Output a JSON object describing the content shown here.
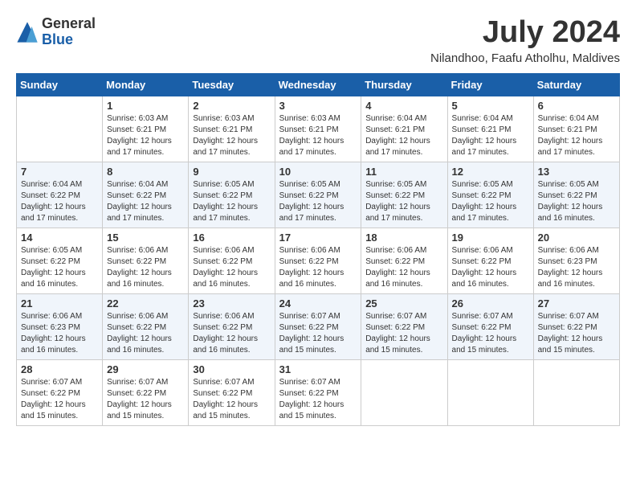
{
  "header": {
    "logo": {
      "general": "General",
      "blue": "Blue"
    },
    "title": "July 2024",
    "location": "Nilandhoo, Faafu Atholhu, Maldives"
  },
  "calendar": {
    "days_of_week": [
      "Sunday",
      "Monday",
      "Tuesday",
      "Wednesday",
      "Thursday",
      "Friday",
      "Saturday"
    ],
    "weeks": [
      [
        {
          "day": "",
          "sunrise": "",
          "sunset": "",
          "daylight": ""
        },
        {
          "day": "1",
          "sunrise": "Sunrise: 6:03 AM",
          "sunset": "Sunset: 6:21 PM",
          "daylight": "Daylight: 12 hours and 17 minutes."
        },
        {
          "day": "2",
          "sunrise": "Sunrise: 6:03 AM",
          "sunset": "Sunset: 6:21 PM",
          "daylight": "Daylight: 12 hours and 17 minutes."
        },
        {
          "day": "3",
          "sunrise": "Sunrise: 6:03 AM",
          "sunset": "Sunset: 6:21 PM",
          "daylight": "Daylight: 12 hours and 17 minutes."
        },
        {
          "day": "4",
          "sunrise": "Sunrise: 6:04 AM",
          "sunset": "Sunset: 6:21 PM",
          "daylight": "Daylight: 12 hours and 17 minutes."
        },
        {
          "day": "5",
          "sunrise": "Sunrise: 6:04 AM",
          "sunset": "Sunset: 6:21 PM",
          "daylight": "Daylight: 12 hours and 17 minutes."
        },
        {
          "day": "6",
          "sunrise": "Sunrise: 6:04 AM",
          "sunset": "Sunset: 6:21 PM",
          "daylight": "Daylight: 12 hours and 17 minutes."
        }
      ],
      [
        {
          "day": "7",
          "sunrise": "Sunrise: 6:04 AM",
          "sunset": "Sunset: 6:22 PM",
          "daylight": "Daylight: 12 hours and 17 minutes."
        },
        {
          "day": "8",
          "sunrise": "Sunrise: 6:04 AM",
          "sunset": "Sunset: 6:22 PM",
          "daylight": "Daylight: 12 hours and 17 minutes."
        },
        {
          "day": "9",
          "sunrise": "Sunrise: 6:05 AM",
          "sunset": "Sunset: 6:22 PM",
          "daylight": "Daylight: 12 hours and 17 minutes."
        },
        {
          "day": "10",
          "sunrise": "Sunrise: 6:05 AM",
          "sunset": "Sunset: 6:22 PM",
          "daylight": "Daylight: 12 hours and 17 minutes."
        },
        {
          "day": "11",
          "sunrise": "Sunrise: 6:05 AM",
          "sunset": "Sunset: 6:22 PM",
          "daylight": "Daylight: 12 hours and 17 minutes."
        },
        {
          "day": "12",
          "sunrise": "Sunrise: 6:05 AM",
          "sunset": "Sunset: 6:22 PM",
          "daylight": "Daylight: 12 hours and 17 minutes."
        },
        {
          "day": "13",
          "sunrise": "Sunrise: 6:05 AM",
          "sunset": "Sunset: 6:22 PM",
          "daylight": "Daylight: 12 hours and 16 minutes."
        }
      ],
      [
        {
          "day": "14",
          "sunrise": "Sunrise: 6:05 AM",
          "sunset": "Sunset: 6:22 PM",
          "daylight": "Daylight: 12 hours and 16 minutes."
        },
        {
          "day": "15",
          "sunrise": "Sunrise: 6:06 AM",
          "sunset": "Sunset: 6:22 PM",
          "daylight": "Daylight: 12 hours and 16 minutes."
        },
        {
          "day": "16",
          "sunrise": "Sunrise: 6:06 AM",
          "sunset": "Sunset: 6:22 PM",
          "daylight": "Daylight: 12 hours and 16 minutes."
        },
        {
          "day": "17",
          "sunrise": "Sunrise: 6:06 AM",
          "sunset": "Sunset: 6:22 PM",
          "daylight": "Daylight: 12 hours and 16 minutes."
        },
        {
          "day": "18",
          "sunrise": "Sunrise: 6:06 AM",
          "sunset": "Sunset: 6:22 PM",
          "daylight": "Daylight: 12 hours and 16 minutes."
        },
        {
          "day": "19",
          "sunrise": "Sunrise: 6:06 AM",
          "sunset": "Sunset: 6:22 PM",
          "daylight": "Daylight: 12 hours and 16 minutes."
        },
        {
          "day": "20",
          "sunrise": "Sunrise: 6:06 AM",
          "sunset": "Sunset: 6:23 PM",
          "daylight": "Daylight: 12 hours and 16 minutes."
        }
      ],
      [
        {
          "day": "21",
          "sunrise": "Sunrise: 6:06 AM",
          "sunset": "Sunset: 6:23 PM",
          "daylight": "Daylight: 12 hours and 16 minutes."
        },
        {
          "day": "22",
          "sunrise": "Sunrise: 6:06 AM",
          "sunset": "Sunset: 6:22 PM",
          "daylight": "Daylight: 12 hours and 16 minutes."
        },
        {
          "day": "23",
          "sunrise": "Sunrise: 6:06 AM",
          "sunset": "Sunset: 6:22 PM",
          "daylight": "Daylight: 12 hours and 16 minutes."
        },
        {
          "day": "24",
          "sunrise": "Sunrise: 6:07 AM",
          "sunset": "Sunset: 6:22 PM",
          "daylight": "Daylight: 12 hours and 15 minutes."
        },
        {
          "day": "25",
          "sunrise": "Sunrise: 6:07 AM",
          "sunset": "Sunset: 6:22 PM",
          "daylight": "Daylight: 12 hours and 15 minutes."
        },
        {
          "day": "26",
          "sunrise": "Sunrise: 6:07 AM",
          "sunset": "Sunset: 6:22 PM",
          "daylight": "Daylight: 12 hours and 15 minutes."
        },
        {
          "day": "27",
          "sunrise": "Sunrise: 6:07 AM",
          "sunset": "Sunset: 6:22 PM",
          "daylight": "Daylight: 12 hours and 15 minutes."
        }
      ],
      [
        {
          "day": "28",
          "sunrise": "Sunrise: 6:07 AM",
          "sunset": "Sunset: 6:22 PM",
          "daylight": "Daylight: 12 hours and 15 minutes."
        },
        {
          "day": "29",
          "sunrise": "Sunrise: 6:07 AM",
          "sunset": "Sunset: 6:22 PM",
          "daylight": "Daylight: 12 hours and 15 minutes."
        },
        {
          "day": "30",
          "sunrise": "Sunrise: 6:07 AM",
          "sunset": "Sunset: 6:22 PM",
          "daylight": "Daylight: 12 hours and 15 minutes."
        },
        {
          "day": "31",
          "sunrise": "Sunrise: 6:07 AM",
          "sunset": "Sunset: 6:22 PM",
          "daylight": "Daylight: 12 hours and 15 minutes."
        },
        {
          "day": "",
          "sunrise": "",
          "sunset": "",
          "daylight": ""
        },
        {
          "day": "",
          "sunrise": "",
          "sunset": "",
          "daylight": ""
        },
        {
          "day": "",
          "sunrise": "",
          "sunset": "",
          "daylight": ""
        }
      ]
    ]
  }
}
